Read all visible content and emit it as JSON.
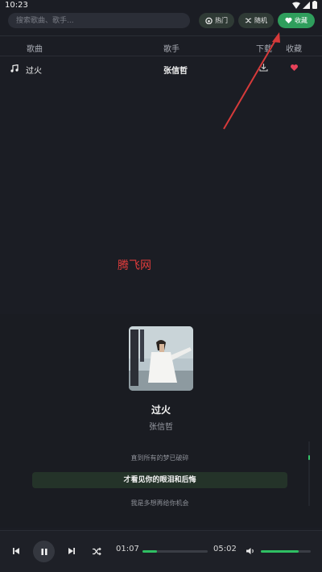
{
  "status": {
    "time": "10:23"
  },
  "search": {
    "placeholder": "搜索歌曲、歌手..."
  },
  "filters": [
    {
      "label": "热门",
      "icon": "flame-icon"
    },
    {
      "label": "随机",
      "icon": "shuffle-icon"
    },
    {
      "label": "收藏",
      "icon": "heart-icon",
      "active": true
    }
  ],
  "table": {
    "headers": {
      "song": "歌曲",
      "artist": "歌手",
      "download": "下载",
      "favorite": "收藏"
    },
    "rows": [
      {
        "song": "过火",
        "artist": "张信哲",
        "favorited": true
      }
    ]
  },
  "watermark": "腾飞网",
  "now_playing": {
    "title": "过火",
    "artist": "张信哲",
    "lyrics": [
      "直到所有的梦已破碎",
      "才看见你的眼泪和后悔",
      "我是多想再给你机会"
    ],
    "active_lyric_index": 1
  },
  "player": {
    "current_time": "01:07",
    "total_time": "05:02",
    "progress": 0.22,
    "volume": 0.75
  },
  "colors": {
    "accent": "#2fbf63",
    "heart": "#e8425a",
    "annotation": "#d63a3a"
  }
}
